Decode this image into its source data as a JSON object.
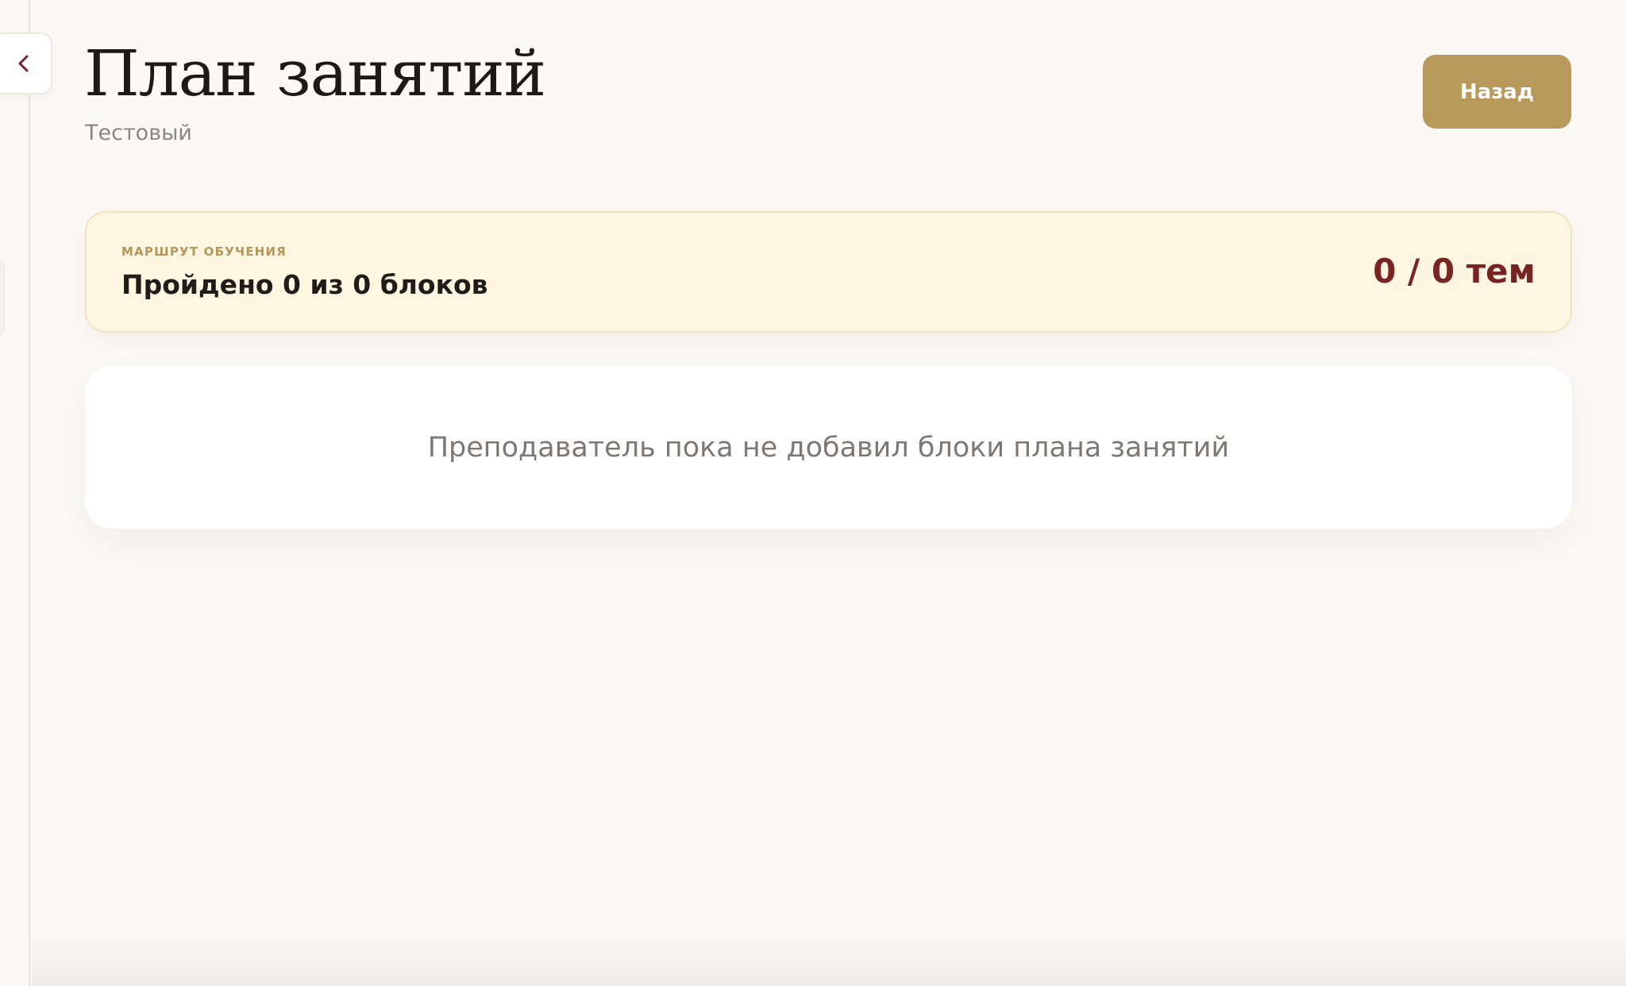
{
  "header": {
    "title": "План занятий",
    "subtitle": "Тестовый",
    "back_button_label": "Назад"
  },
  "sidebar": {
    "collapse_icon": "chevron-left-icon"
  },
  "route": {
    "label": "МАРШРУТ ОБУЧЕНИЯ",
    "progress_text": "Пройдено 0 из 0 блоков",
    "topics_count": "0 / 0 тем"
  },
  "lesson_plan": {
    "empty_message": "Преподаватель пока не добавил блоки плана занятий"
  },
  "colors": {
    "accent": "#b8995c",
    "count_color": "#7a2323",
    "route_background": "#fff6e2",
    "page_background": "#fbf9f6"
  }
}
